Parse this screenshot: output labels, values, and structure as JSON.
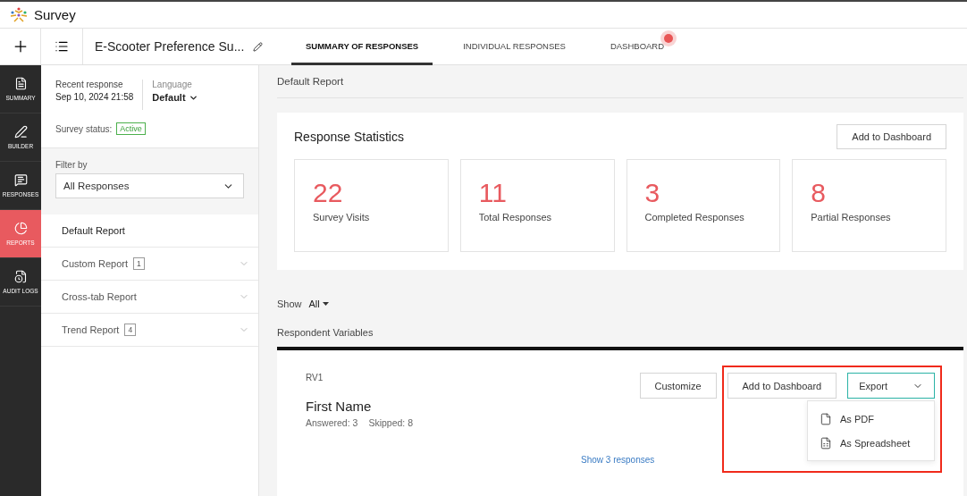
{
  "app": {
    "name": "Survey"
  },
  "survey_title": "E-Scooter Preference Su...",
  "tabs": [
    {
      "label": "SUMMARY OF RESPONSES",
      "selected": true,
      "alert": false
    },
    {
      "label": "INDIVIDUAL RESPONSES",
      "selected": false,
      "alert": false
    },
    {
      "label": "DASHBOARD",
      "selected": false,
      "alert": true
    }
  ],
  "rail": [
    {
      "label": "SUMMARY",
      "kind": "summary",
      "selected": false
    },
    {
      "label": "BUILDER",
      "kind": "builder",
      "selected": false
    },
    {
      "label": "RESPONSES",
      "kind": "responses",
      "selected": false
    },
    {
      "label": "REPORTS",
      "kind": "reports",
      "selected": true
    },
    {
      "label": "AUDIT LOGS",
      "kind": "audit",
      "selected": false
    }
  ],
  "sidebar": {
    "recent_label": "Recent response",
    "recent_value": "Sep 10, 2024 21:58",
    "language_label": "Language",
    "language_value": "Default",
    "status_label": "Survey status:",
    "status_value": "Active",
    "filter_label": "Filter by",
    "filter_value": "All Responses",
    "reports": [
      {
        "label": "Default Report",
        "expandable": false,
        "selected": true
      },
      {
        "label": "Custom Report",
        "count": "1",
        "expandable": true,
        "selected": false
      },
      {
        "label": "Cross-tab Report",
        "expandable": true,
        "selected": false
      },
      {
        "label": "Trend Report",
        "count": "4",
        "expandable": true,
        "selected": false
      }
    ]
  },
  "main": {
    "report_title": "Default Report",
    "stats": {
      "title": "Response Statistics",
      "button": "Add to Dashboard",
      "items": [
        {
          "value": "22",
          "label": "Survey Visits"
        },
        {
          "value": "11",
          "label": "Total Responses"
        },
        {
          "value": "3",
          "label": "Completed Responses"
        },
        {
          "value": "8",
          "label": "Partial Responses"
        }
      ]
    },
    "show_label": "Show",
    "show_value": "All",
    "section_title": "Respondent Variables",
    "question": {
      "code": "RV1",
      "title": "First Name",
      "answered": "Answered: 3",
      "skipped": "Skipped: 8",
      "link": "Show 3 responses",
      "buttons": [
        "Customize",
        "Add to Dashboard"
      ],
      "export": "Export",
      "export_menu": [
        {
          "label": "As PDF",
          "kind": "pdf"
        },
        {
          "label": "As Spreadsheet",
          "kind": "xls"
        }
      ]
    }
  }
}
